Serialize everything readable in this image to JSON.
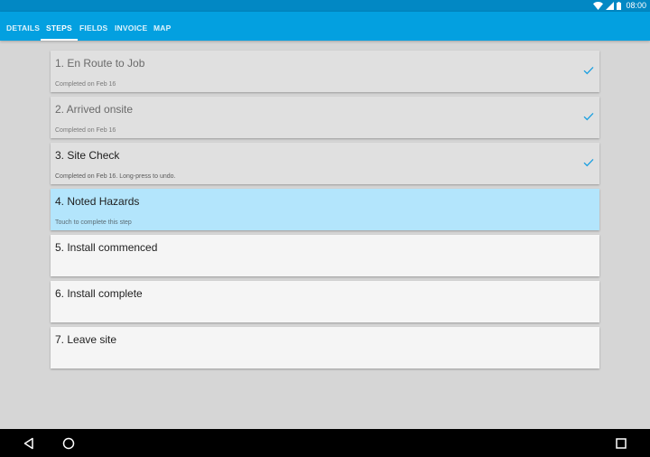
{
  "status_bar": {
    "time": "08:00",
    "icons": [
      "wifi-icon",
      "cell-signal-icon",
      "battery-icon"
    ]
  },
  "tabs": [
    {
      "label": "DETAILS",
      "active": false
    },
    {
      "label": "STEPS",
      "active": true
    },
    {
      "label": "FIELDS",
      "active": false
    },
    {
      "label": "INVOICE",
      "active": false
    },
    {
      "label": "MAP",
      "active": false
    }
  ],
  "steps": [
    {
      "title": "1. En Route to Job",
      "subtitle": "Completed on Feb 16",
      "state": "completed",
      "check_icon": "check-icon"
    },
    {
      "title": "2. Arrived onsite",
      "subtitle": "Completed on Feb 16",
      "state": "completed",
      "check_icon": "check-icon"
    },
    {
      "title": "3. Site Check",
      "subtitle": "Completed on Feb 16. Long-press to undo.",
      "state": "completed",
      "check_icon": "check-icon"
    },
    {
      "title": "4. Noted Hazards",
      "subtitle": "Touch to complete this step",
      "state": "current"
    },
    {
      "title": "5. Install commenced",
      "subtitle": "",
      "state": "pending"
    },
    {
      "title": "6. Install complete",
      "subtitle": "",
      "state": "pending"
    },
    {
      "title": "7. Leave site",
      "subtitle": "",
      "state": "pending"
    }
  ],
  "nav_bar": {
    "buttons": [
      "back-icon",
      "home-icon",
      "recents-icon"
    ]
  },
  "colors": {
    "status_bar": "#0288c4",
    "tab_bar": "#03a0e0",
    "background": "#d6d6d6",
    "completed_card": "#e0e0e0",
    "current_card": "#b3e5fc",
    "pending_card": "#f5f5f5",
    "check": "#1a9fe0"
  }
}
